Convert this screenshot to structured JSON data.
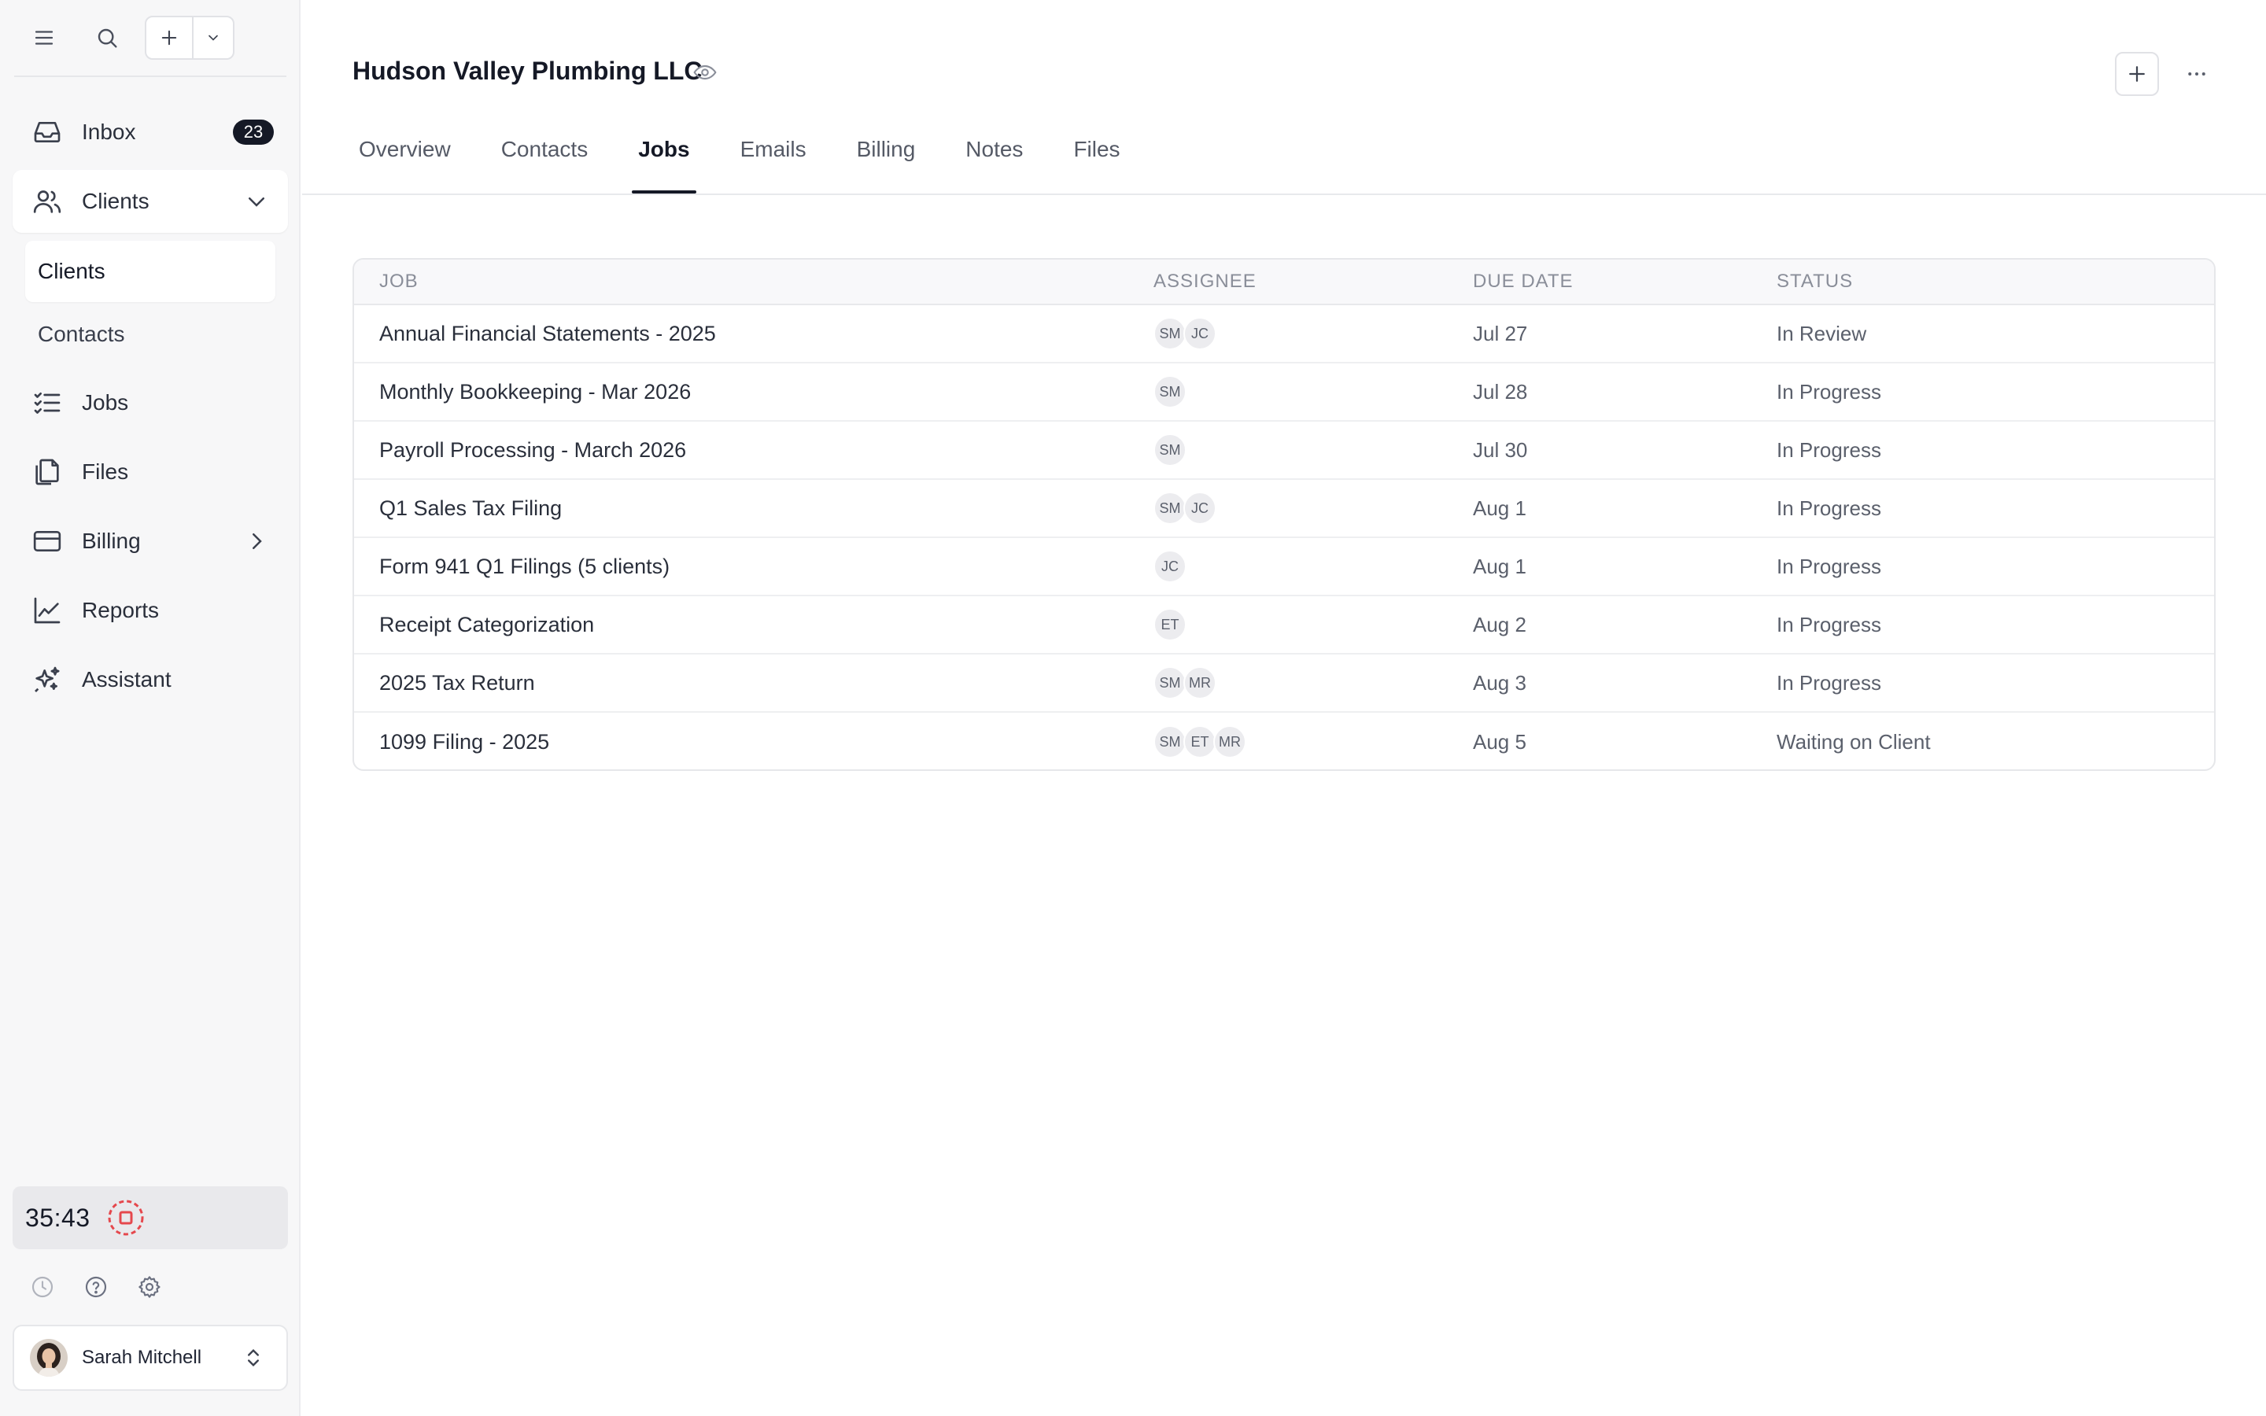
{
  "sidebar": {
    "nav": {
      "inbox": {
        "label": "Inbox",
        "badge": "23"
      },
      "clients": {
        "label": "Clients"
      },
      "clients_sub": {
        "clients": "Clients",
        "contacts": "Contacts"
      },
      "jobs": {
        "label": "Jobs"
      },
      "files": {
        "label": "Files"
      },
      "billing": {
        "label": "Billing"
      },
      "reports": {
        "label": "Reports"
      },
      "assistant": {
        "label": "Assistant"
      }
    },
    "timer": {
      "value": "35:43",
      "stop_color": "#e5484d"
    },
    "user": {
      "name": "Sarah Mitchell"
    }
  },
  "header": {
    "title": "Hudson Valley Plumbing LLC"
  },
  "tabs": [
    {
      "label": "Overview"
    },
    {
      "label": "Contacts"
    },
    {
      "label": "Jobs",
      "active": true
    },
    {
      "label": "Emails"
    },
    {
      "label": "Billing"
    },
    {
      "label": "Notes"
    },
    {
      "label": "Files"
    }
  ],
  "jobs_table": {
    "columns": {
      "job": "JOB",
      "assignee": "ASSIGNEE",
      "due": "DUE DATE",
      "status": "STATUS"
    },
    "rows": [
      {
        "job": "Annual Financial Statements - 2025",
        "assignees": [
          "SM",
          "JC"
        ],
        "due": "Jul 27",
        "status": "In Review"
      },
      {
        "job": "Monthly Bookkeeping - Mar 2026",
        "assignees": [
          "SM"
        ],
        "due": "Jul 28",
        "status": "In Progress"
      },
      {
        "job": "Payroll Processing - March 2026",
        "assignees": [
          "SM"
        ],
        "due": "Jul 30",
        "status": "In Progress"
      },
      {
        "job": "Q1 Sales Tax Filing",
        "assignees": [
          "SM",
          "JC"
        ],
        "due": "Aug 1",
        "status": "In Progress"
      },
      {
        "job": "Form 941 Q1 Filings (5 clients)",
        "assignees": [
          "JC"
        ],
        "due": "Aug 1",
        "status": "In Progress"
      },
      {
        "job": "Receipt Categorization",
        "assignees": [
          "ET"
        ],
        "due": "Aug 2",
        "status": "In Progress"
      },
      {
        "job": "2025 Tax Return",
        "assignees": [
          "SM",
          "MR"
        ],
        "due": "Aug 3",
        "status": "In Progress"
      },
      {
        "job": "1099 Filing - 2025",
        "assignees": [
          "SM",
          "ET",
          "MR"
        ],
        "due": "Aug 5",
        "status": "Waiting on Client"
      }
    ]
  },
  "colors": {
    "accent": "#151926",
    "sidebar_bg": "#f7f7f8",
    "timer_stop": "#e5484d"
  }
}
